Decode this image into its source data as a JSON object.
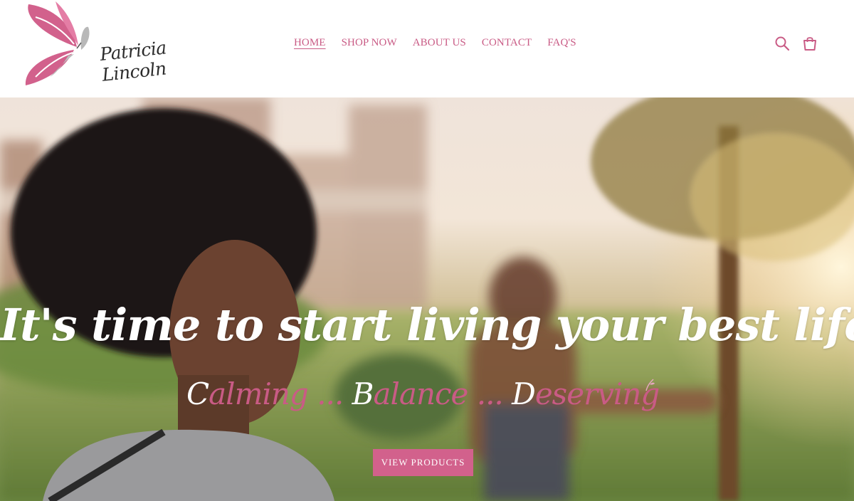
{
  "brand": {
    "logo_text": "Patricia Lincoln",
    "logo_icon": "butterfly-icon",
    "colors": {
      "accent": "#c95b85",
      "button": "#d2618c",
      "text": "#2b2b2b"
    }
  },
  "nav": {
    "items": [
      {
        "label": "HOME",
        "active": true
      },
      {
        "label": "SHOP NOW"
      },
      {
        "label": "ABOUT US"
      },
      {
        "label": "CONTACT"
      },
      {
        "label": "FAQ'S"
      }
    ]
  },
  "header_icons": [
    "search-icon",
    "cart-icon"
  ],
  "hero": {
    "headline": "It's time to start living your best life",
    "tagline": {
      "part1_cap": "C",
      "part1_rest": "alming ... ",
      "part2_cap": "B",
      "part2_rest": "alance ... ",
      "part3_cap": "D",
      "part3_rest": "eserving"
    },
    "button_label": "VIEW PRODUCTS"
  }
}
